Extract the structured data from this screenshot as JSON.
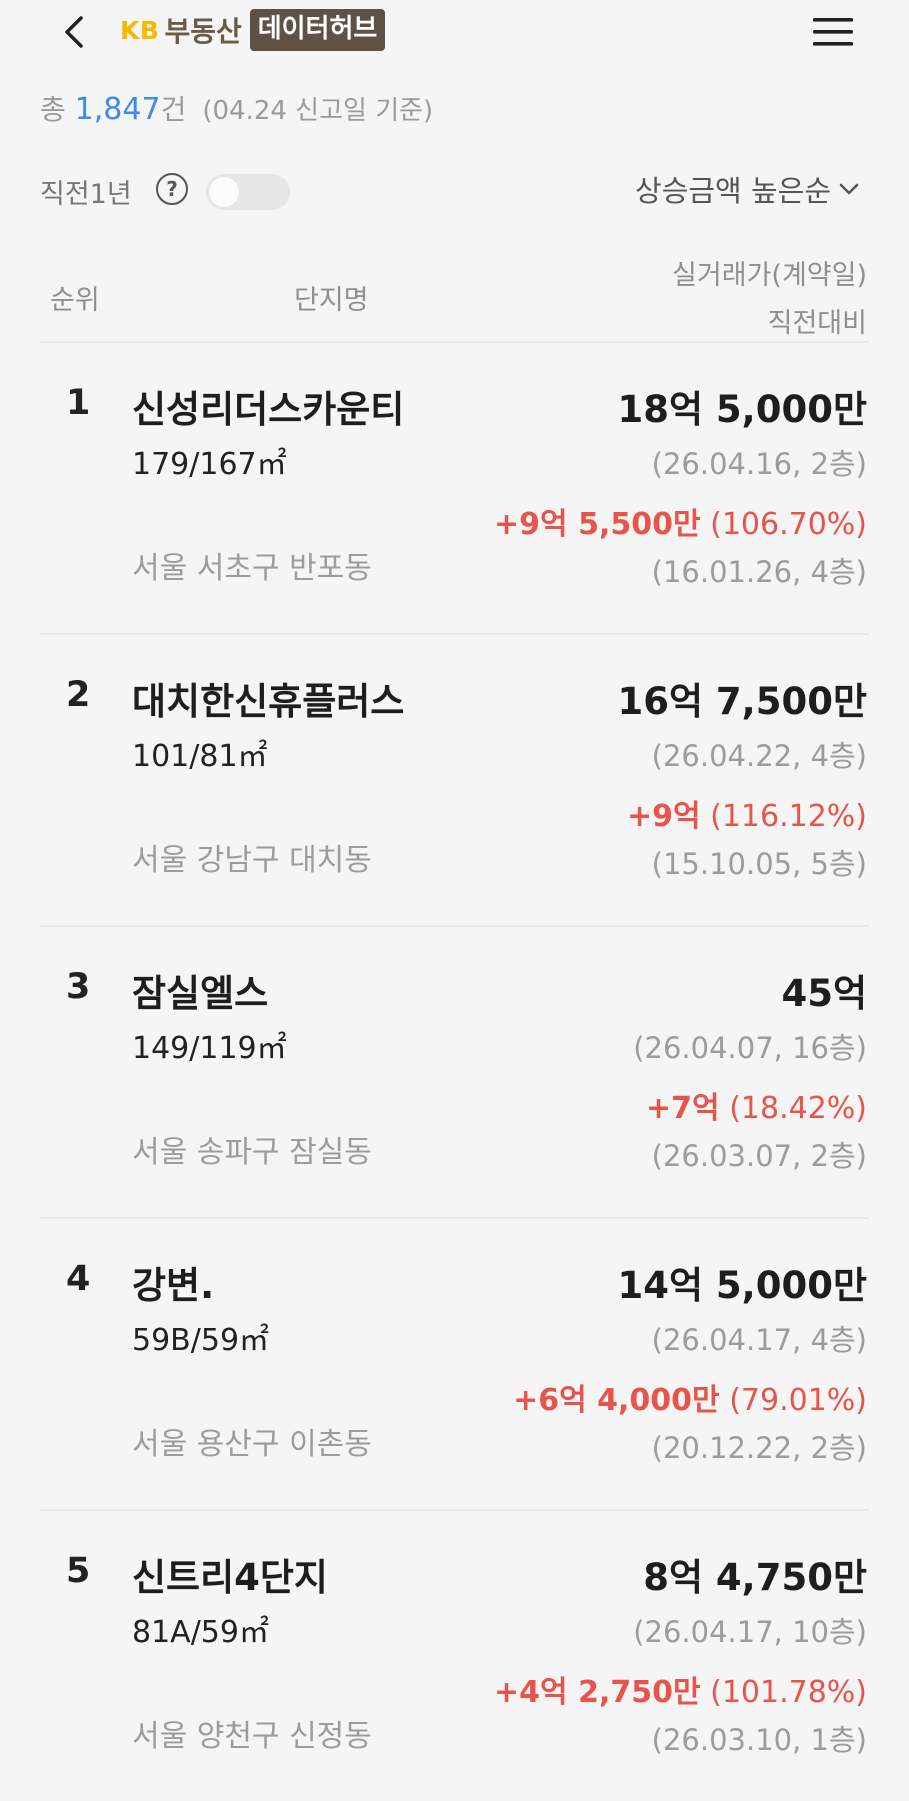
{
  "header": {
    "logo_kb": "KB",
    "logo_name": "부동산",
    "logo_badge": "데이터허브"
  },
  "summary": {
    "prefix": "총 ",
    "count": "1,847",
    "suffix": "건",
    "basis": "(04.24 신고일 기준)"
  },
  "filter": {
    "toggle_label": "직전1년",
    "help": "?",
    "toggle_on": false,
    "sort_label": "상승금액 높은순"
  },
  "columns": {
    "rank": "순위",
    "name": "단지명",
    "price_line1": "실거래가(계약일)",
    "price_line2": "직전대비"
  },
  "rows": [
    {
      "rank": "1",
      "name": "신성리더스카운티",
      "area": "179/167㎡",
      "location": "서울 서초구 반포동",
      "price": "18억 5,000만",
      "price_date": "(26.04.16, 2층)",
      "change_amount": "+9억 5,500만",
      "change_pct": " (106.70%)",
      "prev_date": "(16.01.26, 4층)"
    },
    {
      "rank": "2",
      "name": "대치한신휴플러스",
      "area": "101/81㎡",
      "location": "서울 강남구 대치동",
      "price": "16억 7,500만",
      "price_date": "(26.04.22, 4층)",
      "change_amount": "+9억",
      "change_pct": " (116.12%)",
      "prev_date": "(15.10.05, 5층)"
    },
    {
      "rank": "3",
      "name": "잠실엘스",
      "area": "149/119㎡",
      "location": "서울 송파구 잠실동",
      "price": "45억",
      "price_date": "(26.04.07, 16층)",
      "change_amount": "+7억",
      "change_pct": " (18.42%)",
      "prev_date": "(26.03.07, 2층)"
    },
    {
      "rank": "4",
      "name": "강변.",
      "area": "59B/59㎡",
      "location": "서울 용산구 이촌동",
      "price": "14억 5,000만",
      "price_date": "(26.04.17, 4층)",
      "change_amount": "+6억 4,000만",
      "change_pct": " (79.01%)",
      "prev_date": "(20.12.22, 2층)"
    },
    {
      "rank": "5",
      "name": "신트리4단지",
      "area": "81A/59㎡",
      "location": "서울 양천구 신정동",
      "price": "8억 4,750만",
      "price_date": "(26.04.17, 10층)",
      "change_amount": "+4억 2,750만",
      "change_pct": " (101.78%)",
      "prev_date": "(26.03.10, 1층)"
    }
  ],
  "colors": {
    "accent_blue": "#3d8bf0",
    "change_red": "#e8544a",
    "kb_yellow": "#f6b900",
    "badge_brown": "#5e5146"
  }
}
